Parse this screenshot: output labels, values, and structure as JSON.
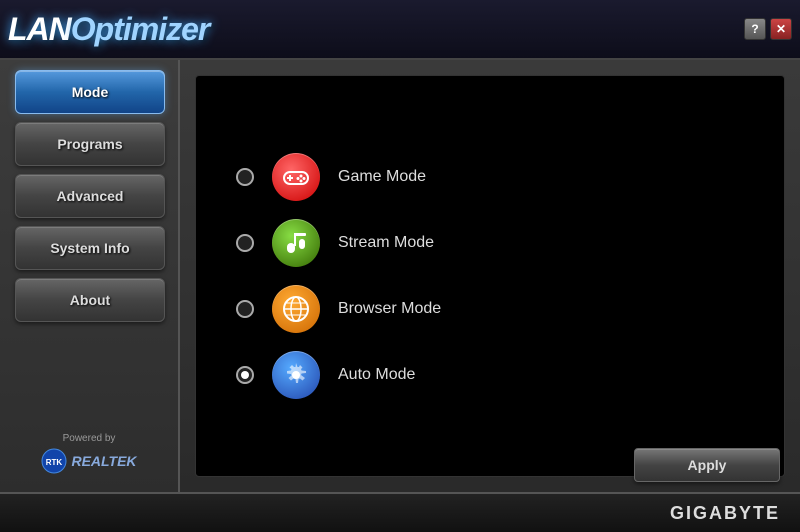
{
  "titlebar": {
    "logo": "LANOptimizer",
    "logo_lan": "LAN",
    "logo_optimizer": "Optimizer",
    "help_btn": "?",
    "close_btn": "✕"
  },
  "sidebar": {
    "items": [
      {
        "id": "mode",
        "label": "Mode",
        "active": true
      },
      {
        "id": "programs",
        "label": "Programs",
        "active": false
      },
      {
        "id": "advanced",
        "label": "Advanced",
        "active": false
      },
      {
        "id": "system-info",
        "label": "System Info",
        "active": false
      },
      {
        "id": "about",
        "label": "About",
        "active": false
      }
    ],
    "powered_by": "Powered by",
    "powered_brand": "REALTEK"
  },
  "modes": [
    {
      "id": "game",
      "label": "Game Mode",
      "icon": "🎮",
      "selected": false,
      "icon_class": "game"
    },
    {
      "id": "stream",
      "label": "Stream Mode",
      "icon": "📻",
      "selected": false,
      "icon_class": "stream"
    },
    {
      "id": "browser",
      "label": "Browser Mode",
      "icon": "🌐",
      "selected": false,
      "icon_class": "browser"
    },
    {
      "id": "auto",
      "label": "Auto Mode",
      "icon": "⚙",
      "selected": true,
      "icon_class": "auto"
    }
  ],
  "footer": {
    "brand": "GIGABYTE",
    "apply_label": "Apply"
  }
}
